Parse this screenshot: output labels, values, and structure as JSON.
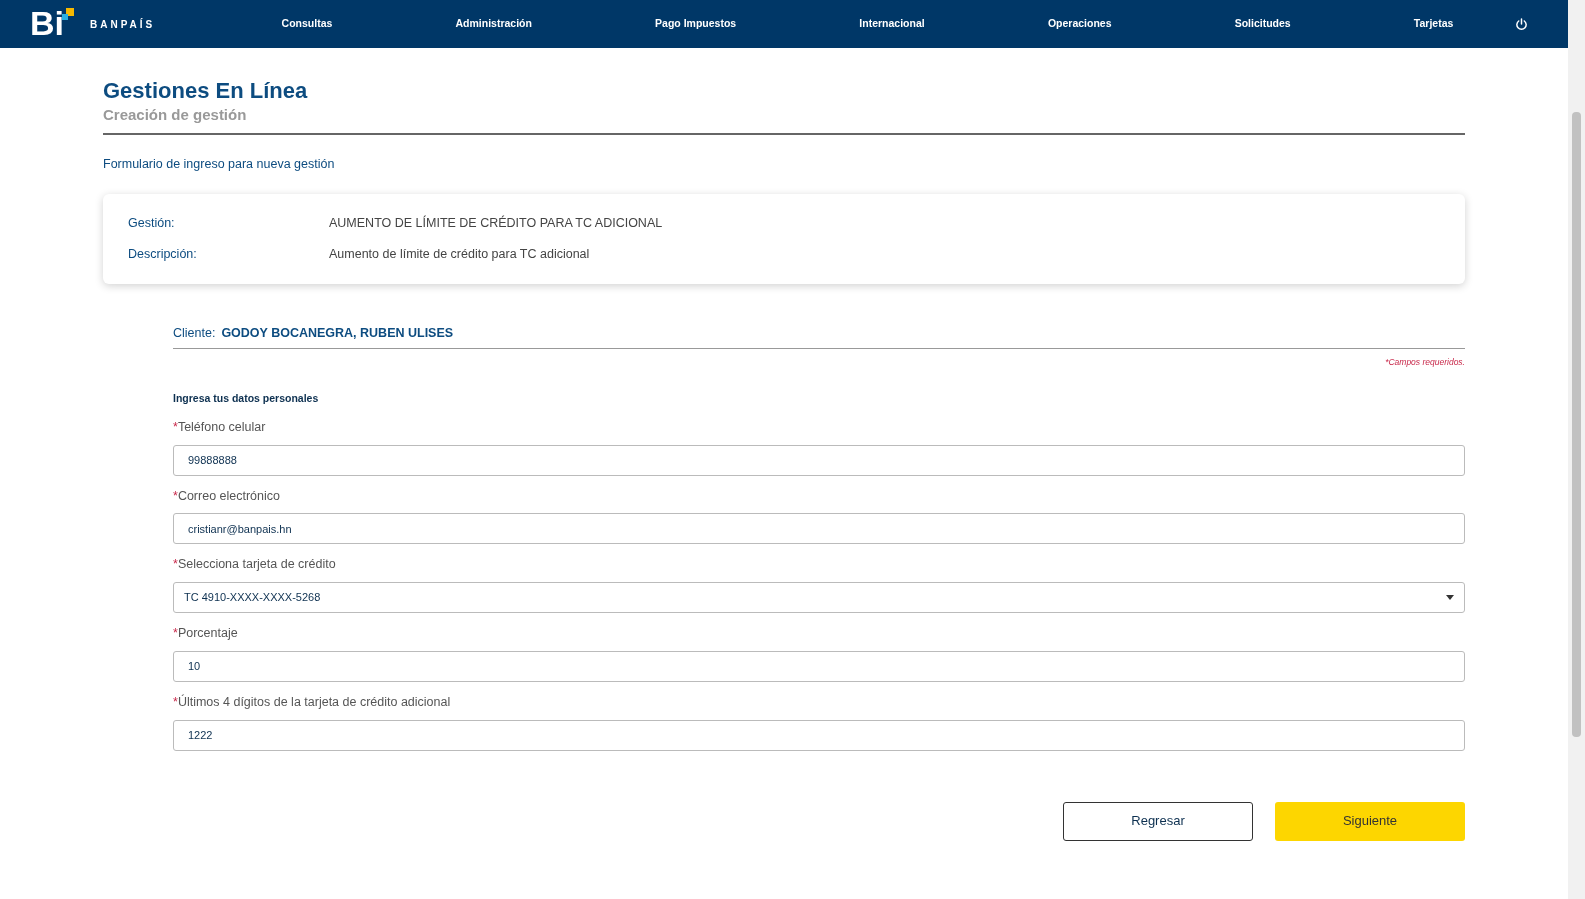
{
  "navbar": {
    "logo_mark": "Bi",
    "logo_text": "BANPAÍS",
    "items": [
      {
        "label": "Consultas"
      },
      {
        "label": "Administración"
      },
      {
        "label": "Pago Impuestos"
      },
      {
        "label": "Internacional"
      },
      {
        "label": "Operaciones"
      },
      {
        "label": "Solicitudes"
      },
      {
        "label": "Tarjetas"
      }
    ]
  },
  "page": {
    "title": "Gestiones En Línea",
    "subtitle": "Creación de gestión",
    "form_title": "Formulario de ingreso para nueva gestión"
  },
  "summary": [
    {
      "label": "Gestión:",
      "value": "AUMENTO DE LÍMITE DE CRÉDITO PARA TC ADICIONAL"
    },
    {
      "label": "Descripción:",
      "value": "Aumento de límite de crédito para TC adicional"
    }
  ],
  "client": {
    "label": "Cliente:",
    "name": "GODOY BOCANEGRA, RUBEN ULISES"
  },
  "required_note": "*Campos requeridos.",
  "section_title": "Ingresa tus datos personales",
  "fields": [
    {
      "kind": "text",
      "mark": "*",
      "label": "Teléfono celular",
      "value": "99888888"
    },
    {
      "kind": "text",
      "mark": "*",
      "label": "Correo electrónico",
      "value": "cristianr@banpais.hn"
    },
    {
      "kind": "select",
      "mark": "*",
      "label": "Selecciona tarjeta de crédito",
      "value": "TC 4910-XXXX-XXXX-5268"
    },
    {
      "kind": "text",
      "mark": "*",
      "label": "Porcentaje",
      "value": "10"
    },
    {
      "kind": "text",
      "mark": "*",
      "label": "Últimos 4 dígitos de la tarjeta de crédito adicional",
      "value": "1222"
    }
  ],
  "buttons": [
    {
      "kind": "outline",
      "label": "Regresar"
    },
    {
      "kind": "primary",
      "label": "Siguiente"
    }
  ]
}
